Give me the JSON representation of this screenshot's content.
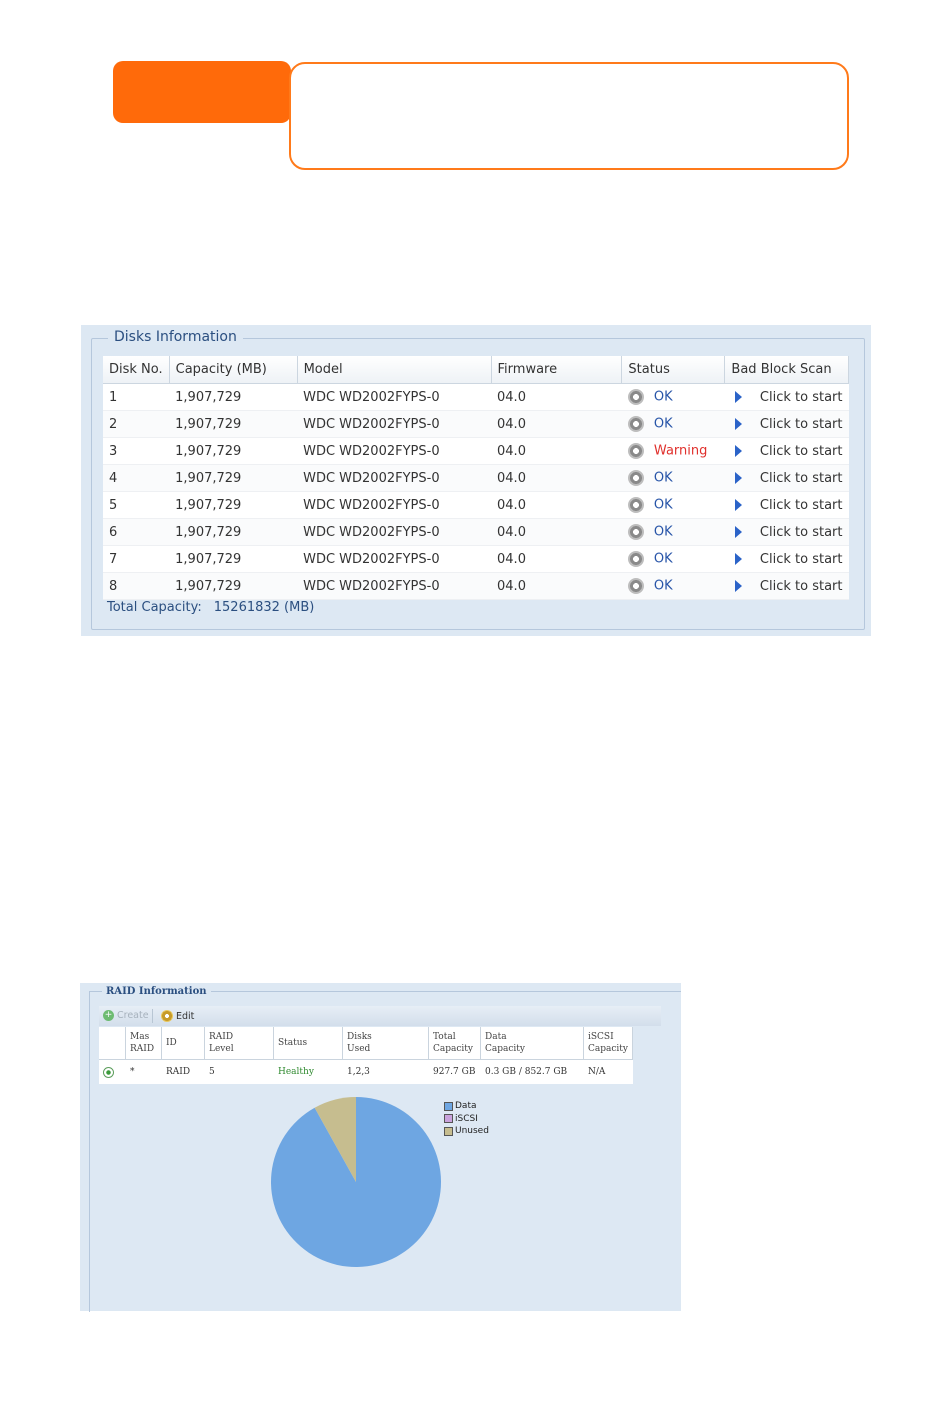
{
  "disks": {
    "title": "Disks Information",
    "columns": [
      "Disk No.",
      "Capacity (MB)",
      "Model",
      "Firmware",
      "Status",
      "Bad Block Scan"
    ],
    "rows": [
      {
        "no": "1",
        "capacity": "1,907,729",
        "model": "WDC WD2002FYPS-0",
        "firmware": "04.0",
        "status": "OK",
        "scan": "Click to start"
      },
      {
        "no": "2",
        "capacity": "1,907,729",
        "model": "WDC WD2002FYPS-0",
        "firmware": "04.0",
        "status": "OK",
        "scan": "Click to start"
      },
      {
        "no": "3",
        "capacity": "1,907,729",
        "model": "WDC WD2002FYPS-0",
        "firmware": "04.0",
        "status": "Warning",
        "scan": "Click to start"
      },
      {
        "no": "4",
        "capacity": "1,907,729",
        "model": "WDC WD2002FYPS-0",
        "firmware": "04.0",
        "status": "OK",
        "scan": "Click to start"
      },
      {
        "no": "5",
        "capacity": "1,907,729",
        "model": "WDC WD2002FYPS-0",
        "firmware": "04.0",
        "status": "OK",
        "scan": "Click to start"
      },
      {
        "no": "6",
        "capacity": "1,907,729",
        "model": "WDC WD2002FYPS-0",
        "firmware": "04.0",
        "status": "OK",
        "scan": "Click to start"
      },
      {
        "no": "7",
        "capacity": "1,907,729",
        "model": "WDC WD2002FYPS-0",
        "firmware": "04.0",
        "status": "OK",
        "scan": "Click to start"
      },
      {
        "no": "8",
        "capacity": "1,907,729",
        "model": "WDC WD2002FYPS-0",
        "firmware": "04.0",
        "status": "OK",
        "scan": "Click to start"
      }
    ],
    "total_label": "Total Capacity:",
    "total_value": "15261832 (MB)",
    "status_colors": {
      "ok": "#2855a8",
      "warning": "#e0302c"
    }
  },
  "raid": {
    "title": "RAID Information",
    "toolbar": {
      "create": "Create",
      "edit": "Edit"
    },
    "columns": [
      [
        "",
        ""
      ],
      [
        "Mas",
        "RAID"
      ],
      [
        "ID",
        ""
      ],
      [
        "RAID",
        "Level"
      ],
      [
        "Status",
        ""
      ],
      [
        "Disks",
        "Used"
      ],
      [
        "Total",
        "Capacity"
      ],
      [
        "Data",
        "Capacity"
      ],
      [
        "iSCSI",
        "Capacity"
      ]
    ],
    "row": {
      "master": "*",
      "id": "RAID",
      "level": "5",
      "status": "Healthy",
      "disks": "1,2,3",
      "total": "927.7 GB",
      "data": "0.3 GB / 852.7 GB",
      "iscsi": "N/A"
    }
  },
  "chart_data": {
    "type": "pie",
    "labels": [
      "Data",
      "iSCSI",
      "Unused"
    ],
    "values": [
      852.7,
      0,
      75.0
    ],
    "colors": [
      "#6ea6e2",
      "#c9a2dc",
      "#c6bd8f"
    ],
    "legend": "top-right"
  }
}
